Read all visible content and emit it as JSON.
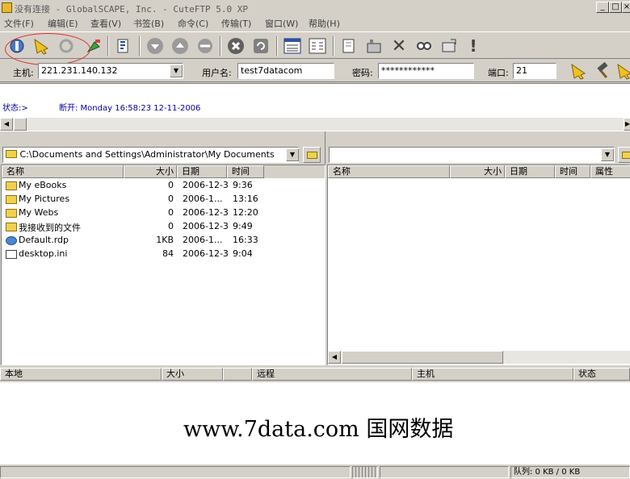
{
  "window": {
    "title": "没有连接 - GlobalSCAPE, Inc. - CuteFTP 5.0 XP"
  },
  "menu": [
    "文件(F)",
    "编辑(E)",
    "查看(V)",
    "书签(B)",
    "命令(C)",
    "传输(T)",
    "窗口(W)",
    "帮助(H)"
  ],
  "quick_connect": {
    "host_label": "主机:",
    "host": "221.231.140.132",
    "user_label": "用户名:",
    "user": "test7datacom",
    "pass_label": "密码:",
    "pass": "************",
    "port_label": "端口:",
    "port": "21"
  },
  "log": {
    "status_label": "状态:>",
    "message": "断开: Monday 16:58:23 12-11-2006"
  },
  "local": {
    "path": "C:\\Documents and Settings\\Administrator\\My Documents",
    "columns": [
      "名称",
      "大小",
      "日期",
      "时间"
    ],
    "files": [
      {
        "name": "My eBooks",
        "size": "0",
        "date": "2006-12-3",
        "time": "9:36",
        "icon": "folder-icon"
      },
      {
        "name": "My Pictures",
        "size": "0",
        "date": "2006-1...",
        "time": "13:16",
        "icon": "folder-icon"
      },
      {
        "name": "My Webs",
        "size": "0",
        "date": "2006-12-3",
        "time": "12:20",
        "icon": "folder-icon"
      },
      {
        "name": "我接收到的文件",
        "size": "0",
        "date": "2006-12-3",
        "time": "9:49",
        "icon": "folder-icon"
      },
      {
        "name": "Default.rdp",
        "size": "1KB",
        "date": "2006-1...",
        "time": "16:33",
        "icon": "rdp-file-icon"
      },
      {
        "name": "desktop.ini",
        "size": "84",
        "date": "2006-12-3",
        "time": "9:04",
        "icon": "ini-file-icon"
      }
    ]
  },
  "remote": {
    "path": "",
    "columns": [
      "名称",
      "大小",
      "日期",
      "时间",
      "属性"
    ]
  },
  "queue": {
    "columns": [
      "本地",
      "大小",
      "远程",
      "主机",
      "状态"
    ]
  },
  "watermark": "www.7data.com  国网数据",
  "statusbar": {
    "queue": "队列: 0 KB / 0 KB"
  }
}
